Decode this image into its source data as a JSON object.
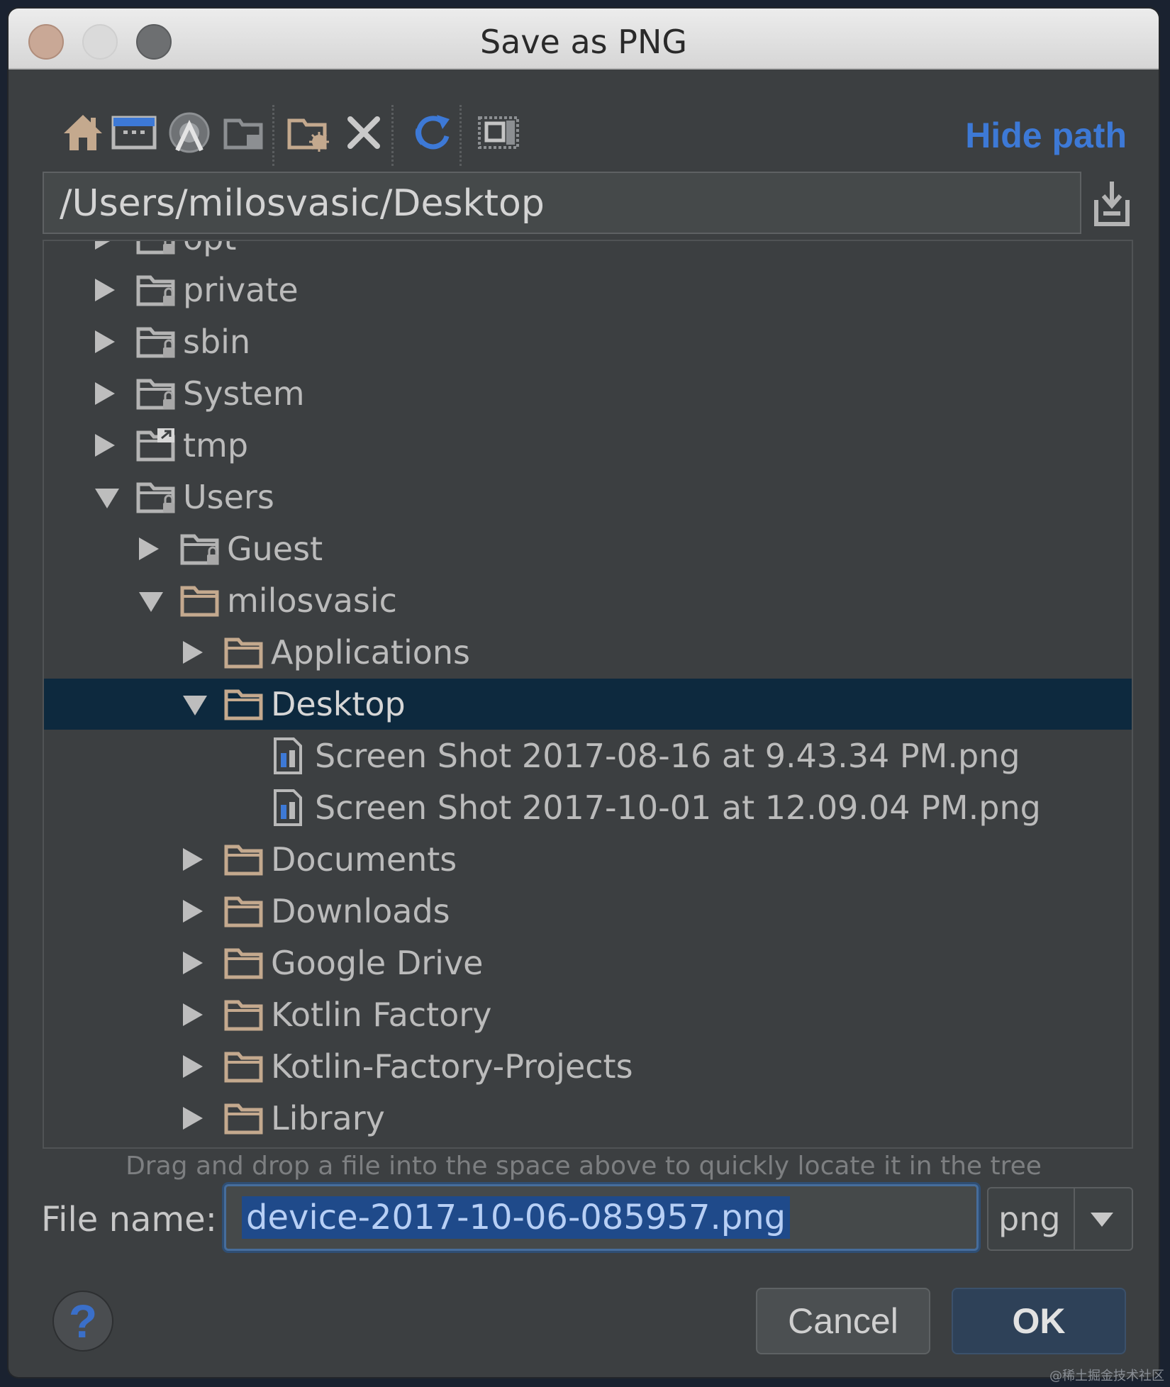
{
  "window": {
    "title": "Save as PNG"
  },
  "toolbar": {
    "hide_path": "Hide path",
    "icons": [
      "home-icon",
      "desktop-icon",
      "android-project-icon",
      "module-icon",
      "new-folder-icon",
      "delete-icon",
      "refresh-icon",
      "show-hidden-icon"
    ]
  },
  "path": {
    "value": "/Users/milosvasic/Desktop"
  },
  "tree": {
    "rows": [
      {
        "label": "opt",
        "indent": 0,
        "state": "collapsed",
        "type": "folder-locked"
      },
      {
        "label": "private",
        "indent": 0,
        "state": "collapsed",
        "type": "folder-locked"
      },
      {
        "label": "sbin",
        "indent": 0,
        "state": "collapsed",
        "type": "folder-locked"
      },
      {
        "label": "System",
        "indent": 0,
        "state": "collapsed",
        "type": "folder-locked"
      },
      {
        "label": "tmp",
        "indent": 0,
        "state": "collapsed",
        "type": "folder-link"
      },
      {
        "label": "Users",
        "indent": 0,
        "state": "expanded",
        "type": "folder-locked"
      },
      {
        "label": "Guest",
        "indent": 1,
        "state": "collapsed",
        "type": "folder-locked"
      },
      {
        "label": "milosvasic",
        "indent": 1,
        "state": "expanded",
        "type": "folder"
      },
      {
        "label": "Applications",
        "indent": 2,
        "state": "collapsed",
        "type": "folder"
      },
      {
        "label": "Desktop",
        "indent": 2,
        "state": "expanded",
        "type": "folder",
        "selected": true
      },
      {
        "label": "Screen Shot 2017-08-16 at 9.43.34 PM.png",
        "indent": 3,
        "state": "leaf",
        "type": "image-file"
      },
      {
        "label": "Screen Shot 2017-10-01 at 12.09.04 PM.png",
        "indent": 3,
        "state": "leaf",
        "type": "image-file"
      },
      {
        "label": "Documents",
        "indent": 2,
        "state": "collapsed",
        "type": "folder"
      },
      {
        "label": "Downloads",
        "indent": 2,
        "state": "collapsed",
        "type": "folder"
      },
      {
        "label": "Google Drive",
        "indent": 2,
        "state": "collapsed",
        "type": "folder"
      },
      {
        "label": "Kotlin Factory",
        "indent": 2,
        "state": "collapsed",
        "type": "folder"
      },
      {
        "label": "Kotlin-Factory-Projects",
        "indent": 2,
        "state": "collapsed",
        "type": "folder"
      },
      {
        "label": "Library",
        "indent": 2,
        "state": "collapsed",
        "type": "folder"
      }
    ]
  },
  "hint": "Drag and drop a file into the space above to quickly locate it in the tree",
  "file_name": {
    "label": "File name:",
    "value": "device-2017-10-06-085957.png",
    "extension": "png"
  },
  "buttons": {
    "cancel": "Cancel",
    "ok": "OK",
    "help": "?"
  },
  "colors": {
    "accent": "#3d79d6",
    "selection": "#0d293e",
    "background": "#3c3f41"
  },
  "watermark": "@稀土掘金技术社区"
}
